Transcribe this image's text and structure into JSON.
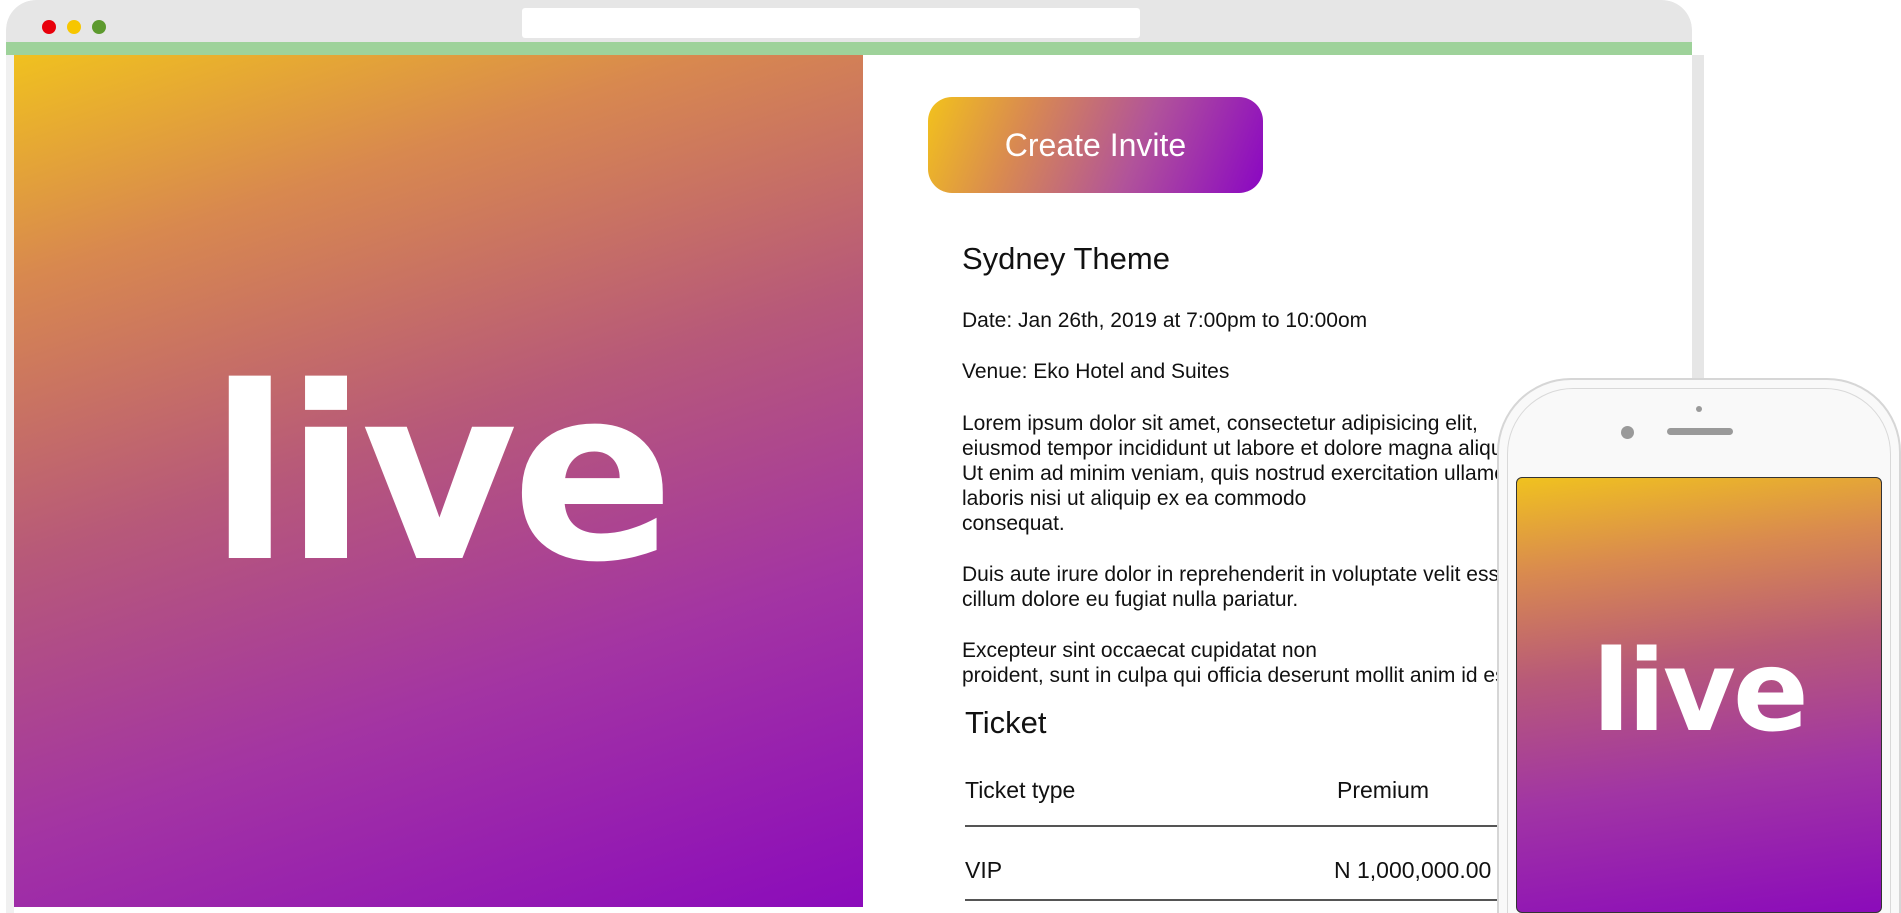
{
  "hero": {
    "logo_text": "live"
  },
  "actions": {
    "create_invite_label": "Create Invite"
  },
  "event": {
    "title": "Sydney Theme",
    "date": "Date: Jan 26th, 2019 at 7:00pm to 10:00om",
    "venue": "Venue: Eko Hotel and Suites",
    "description": [
      [
        "Lorem ipsum dolor sit amet, consectetur adipisicing elit,",
        "eiusmod tempor incididunt ut labore et dolore magna aliqua.",
        "Ut enim ad minim veniam, quis nostrud exercitation ullamco",
        "laboris nisi ut aliquip ex ea commodo",
        "consequat."
      ],
      [
        "Duis aute irure dolor in reprehenderit in voluptate velit esse",
        "cillum dolore eu fugiat nulla pariatur."
      ],
      [
        "Excepteur sint occaecat cupidatat non",
        "proident, sunt in culpa qui officia deserunt mollit anim id est laborum."
      ]
    ]
  },
  "ticket": {
    "heading": "Ticket",
    "columns": [
      "Ticket type",
      "Premium"
    ],
    "rows": [
      {
        "type": "VIP",
        "price": "N 1,000,000.00"
      }
    ]
  },
  "phone": {
    "logo_text": "live"
  },
  "colors": {
    "gradient_start": "#f0c11f",
    "gradient_end": "#8b0bbb",
    "chrome_gray": "#e6e6e6",
    "accent_strip": "#9ed29a",
    "traffic_red": "#e8000b",
    "traffic_yellow": "#f7c600",
    "traffic_green": "#5d9a2e"
  }
}
